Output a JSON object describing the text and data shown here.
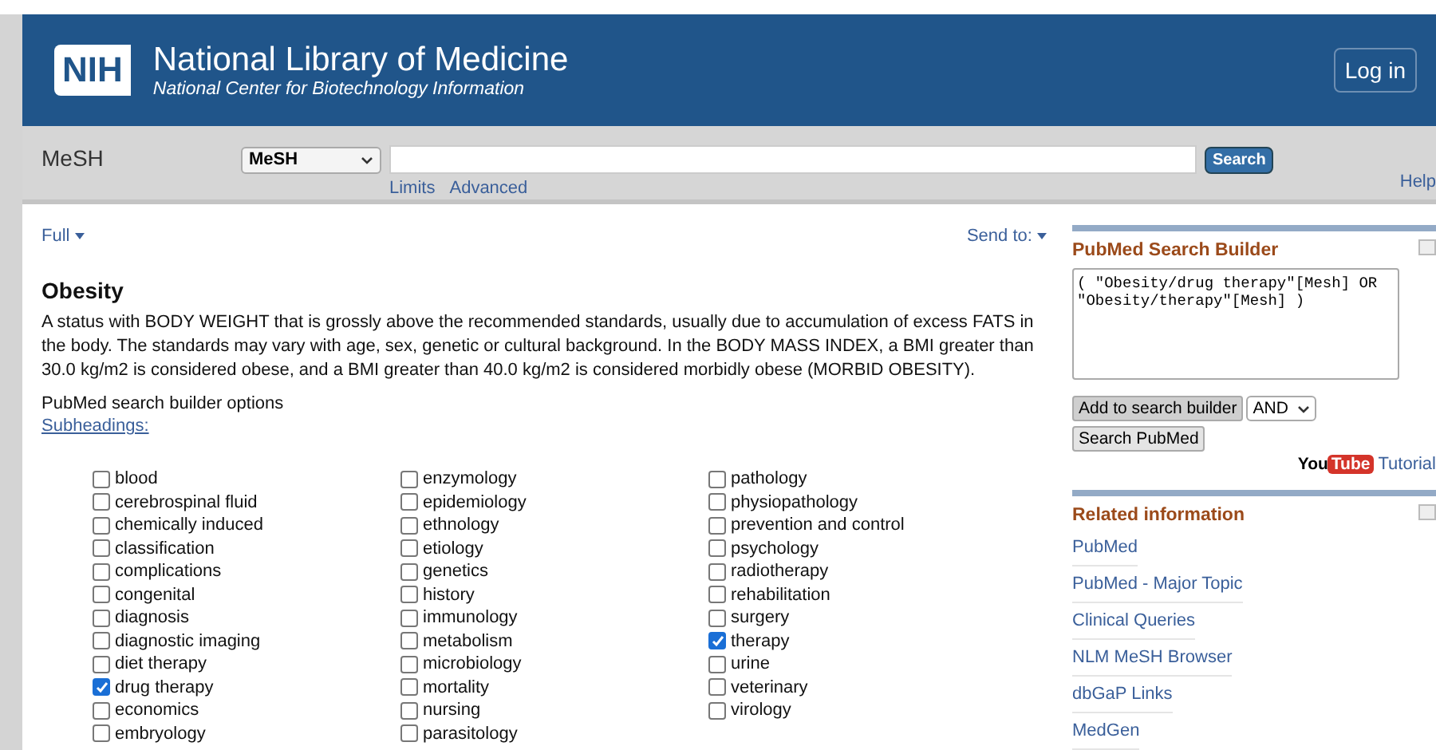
{
  "header": {
    "logo": "NIH",
    "title": "National Library of Medicine",
    "subtitle": "National Center for Biotechnology Information",
    "login": "Log in"
  },
  "searchbar": {
    "database_label": "MeSH",
    "database_select": "MeSH",
    "search_button": "Search",
    "links": [
      "Limits",
      "Advanced"
    ],
    "help": "Help"
  },
  "content": {
    "format": "Full",
    "send_to": "Send to:",
    "heading": "Obesity",
    "description": "A status with BODY WEIGHT that is grossly above the recommended standards, usually due to accumulation of excess FATS in the body. The standards may vary with age, sex, genetic or cultural background. In the BODY MASS INDEX, a BMI greater than 30.0 kg/m2 is considered obese, and a BMI greater than 40.0 kg/m2 is considered morbidly obese (MORBID OBESITY).",
    "options_label": "PubMed search builder options",
    "subheadings_link": "Subheadings:",
    "subheadings": [
      [
        {
          "label": "blood",
          "checked": false
        },
        {
          "label": "cerebrospinal fluid",
          "checked": false
        },
        {
          "label": "chemically induced",
          "checked": false
        },
        {
          "label": "classification",
          "checked": false
        },
        {
          "label": "complications",
          "checked": false
        },
        {
          "label": "congenital",
          "checked": false
        },
        {
          "label": "diagnosis",
          "checked": false
        },
        {
          "label": "diagnostic imaging",
          "checked": false
        },
        {
          "label": "diet therapy",
          "checked": false
        },
        {
          "label": "drug therapy",
          "checked": true
        },
        {
          "label": "economics",
          "checked": false
        },
        {
          "label": "embryology",
          "checked": false
        }
      ],
      [
        {
          "label": "enzymology",
          "checked": false
        },
        {
          "label": "epidemiology",
          "checked": false
        },
        {
          "label": "ethnology",
          "checked": false
        },
        {
          "label": "etiology",
          "checked": false
        },
        {
          "label": "genetics",
          "checked": false
        },
        {
          "label": "history",
          "checked": false
        },
        {
          "label": "immunology",
          "checked": false
        },
        {
          "label": "metabolism",
          "checked": false
        },
        {
          "label": "microbiology",
          "checked": false
        },
        {
          "label": "mortality",
          "checked": false
        },
        {
          "label": "nursing",
          "checked": false
        },
        {
          "label": "parasitology",
          "checked": false
        }
      ],
      [
        {
          "label": "pathology",
          "checked": false
        },
        {
          "label": "physiopathology",
          "checked": false
        },
        {
          "label": "prevention and control",
          "checked": false
        },
        {
          "label": "psychology",
          "checked": false
        },
        {
          "label": "radiotherapy",
          "checked": false
        },
        {
          "label": "rehabilitation",
          "checked": false
        },
        {
          "label": "surgery",
          "checked": false
        },
        {
          "label": "therapy",
          "checked": true
        },
        {
          "label": "urine",
          "checked": false
        },
        {
          "label": "veterinary",
          "checked": false
        },
        {
          "label": "virology",
          "checked": false
        }
      ]
    ]
  },
  "sidebar": {
    "builder_title": "PubMed Search Builder",
    "query": "( \"Obesity/drug therapy\"[Mesh] OR \"Obesity/therapy\"[Mesh] )",
    "add_button": "Add to search builder",
    "operator": "AND",
    "search_button": "Search PubMed",
    "youtube_you": "You",
    "youtube_tube": "Tube",
    "tutorial": "Tutorial",
    "related_title": "Related information",
    "related": [
      "PubMed",
      "PubMed - Major Topic",
      "Clinical Queries",
      "NLM MeSH Browser",
      "dbGaP Links",
      "MedGen"
    ]
  }
}
